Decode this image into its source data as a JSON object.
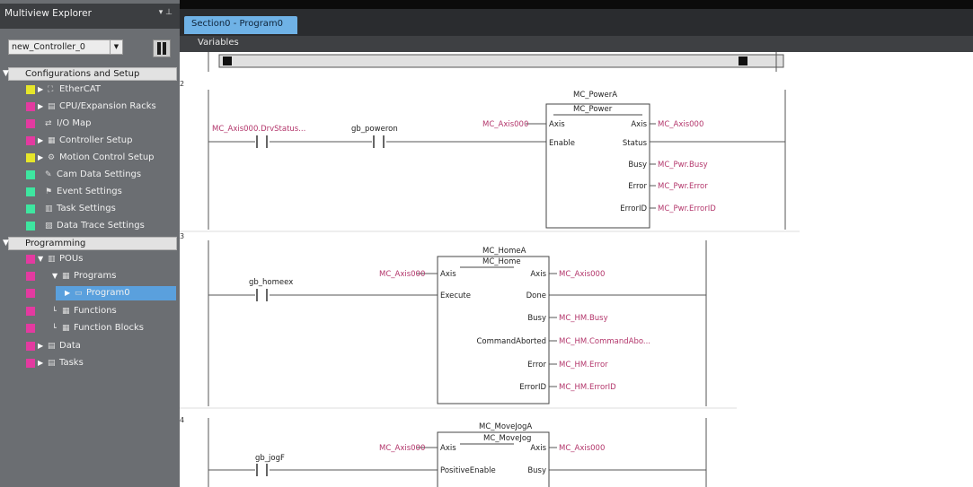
{
  "explorer": {
    "title": "Multiview Explorer",
    "pin": "▾ ⊥",
    "controller": "new_Controller_0",
    "config_section": "Configurations and Setup",
    "config_items": [
      {
        "label": "EtherCAT",
        "color": "#e6e62a"
      },
      {
        "label": "CPU/Expansion Racks",
        "color": "#e33aa0"
      },
      {
        "label": "I/O Map",
        "color": "#e33aa0"
      },
      {
        "label": "Controller Setup",
        "color": "#e33aa0"
      },
      {
        "label": "Motion Control Setup",
        "color": "#e6e62a"
      },
      {
        "label": "Cam Data Settings",
        "color": "#3ee6a0"
      },
      {
        "label": "Event Settings",
        "color": "#3ee6a0"
      },
      {
        "label": "Task Settings",
        "color": "#3ee6a0"
      },
      {
        "label": "Data Trace Settings",
        "color": "#3ee6a0"
      }
    ],
    "prog_section": "Programming",
    "prog_items": [
      {
        "label": "POUs",
        "color": "#e33aa0"
      },
      {
        "label": "Programs",
        "color": "#e33aa0"
      },
      {
        "label": "Program0",
        "color": "#e33aa0"
      },
      {
        "label": "Functions",
        "color": "#e33aa0"
      },
      {
        "label": "Function Blocks",
        "color": "#e33aa0"
      },
      {
        "label": "Data",
        "color": "#e33aa0"
      },
      {
        "label": "Tasks",
        "color": "#e33aa0"
      }
    ]
  },
  "tab": {
    "label": "Section0 - Program0"
  },
  "variables_label": "Variables",
  "rungs": {
    "r2": {
      "number": "2",
      "contact1_var": "MC_Axis000.DrvStatus...",
      "contact2_var": "gb_poweron",
      "instance": "MC_PowerA",
      "fb": "MC_Power",
      "in_axis_var": "MC_Axis000",
      "pins_left": [
        "Axis",
        "Enable"
      ],
      "pins_right": [
        "Axis",
        "Status",
        "Busy",
        "Error",
        "ErrorID"
      ],
      "outputs": [
        "MC_Axis000",
        "",
        "MC_Pwr.Busy",
        "MC_Pwr.Error",
        "MC_Pwr.ErrorID"
      ]
    },
    "r3": {
      "number": "3",
      "contact_var": "gb_homeex",
      "instance": "MC_HomeA",
      "fb": "MC_Home",
      "in_axis_var": "MC_Axis000",
      "pins_left": [
        "Axis",
        "Execute"
      ],
      "pins_right": [
        "Axis",
        "Done",
        "Busy",
        "CommandAborted",
        "Error",
        "ErrorID"
      ],
      "outputs": [
        "MC_Axis000",
        "",
        "MC_HM.Busy",
        "MC_HM.CommandAbo...",
        "MC_HM.Error",
        "MC_HM.ErrorID"
      ]
    },
    "r4": {
      "number": "4",
      "contact_var": "gb_jogF",
      "instance": "MC_MoveJogA",
      "fb": "MC_MoveJog",
      "in_axis_var": "MC_Axis000",
      "pins_left": [
        "Axis",
        "PositiveEnable"
      ],
      "pins_right": [
        "Axis",
        "Busy"
      ],
      "outputs": [
        "MC_Axis000",
        ""
      ]
    }
  },
  "colors": {
    "variable": "#b3366b",
    "rail": "#555555",
    "accent": "#6fb2e6"
  }
}
